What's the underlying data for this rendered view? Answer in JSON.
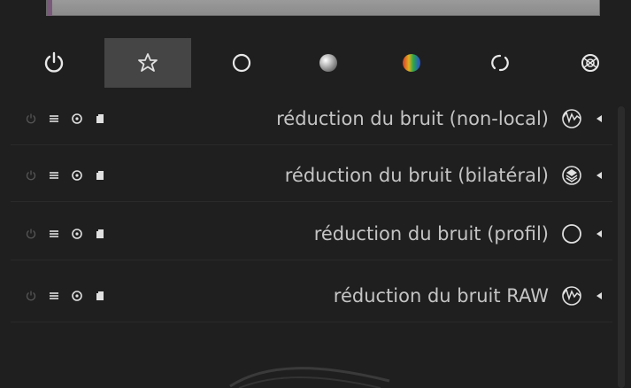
{
  "group_tabs": [
    {
      "icon": "power-icon",
      "active": false
    },
    {
      "icon": "star-icon",
      "active": true
    },
    {
      "icon": "circle-icon",
      "active": false
    },
    {
      "icon": "gradient-sphere-icon",
      "active": false
    },
    {
      "icon": "color-sphere-icon",
      "active": false
    },
    {
      "icon": "rotate-icon",
      "active": false
    },
    {
      "icon": "effect-icon",
      "active": false
    }
  ],
  "modules": [
    {
      "label": "réduction du bruit (non-local)",
      "icon": "wave-circle-icon"
    },
    {
      "label": "réduction du bruit (bilatéral)",
      "icon": "layers-circle-icon"
    },
    {
      "label": "réduction du bruit (profil)",
      "icon": "circle-outline-icon"
    },
    {
      "label": "réduction du bruit RAW",
      "icon": "wave-circle-icon"
    }
  ],
  "colors": {
    "background": "#1f1f1f",
    "active_tab": "#454545",
    "text": "#c4c4c4",
    "dim_icon": "#5a5a5a"
  }
}
